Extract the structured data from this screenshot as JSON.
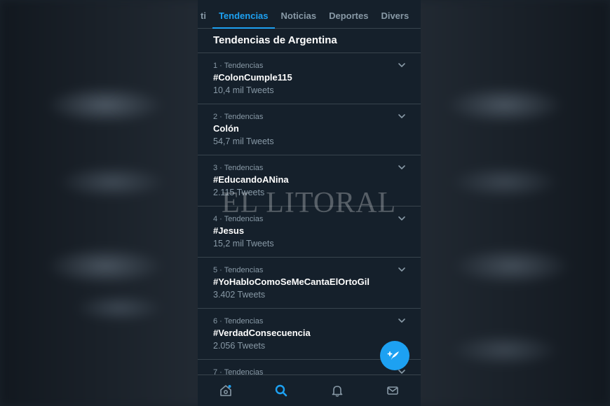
{
  "tabs": [
    {
      "label": "ti",
      "active": false
    },
    {
      "label": "Tendencias",
      "active": true
    },
    {
      "label": "Noticias",
      "active": false
    },
    {
      "label": "Deportes",
      "active": false
    },
    {
      "label": "Divers",
      "active": false
    }
  ],
  "section_title": "Tendencias de Argentina",
  "trends": [
    {
      "meta": "1 · Tendencias",
      "name": "#ColonCumple115",
      "count": "10,4 mil Tweets"
    },
    {
      "meta": "2 · Tendencias",
      "name": "Colón",
      "count": "54,7 mil Tweets"
    },
    {
      "meta": "3 · Tendencias",
      "name": "#EducandoANina",
      "count": "2.115 Tweets"
    },
    {
      "meta": "4 · Tendencias",
      "name": "#Jesus",
      "count": "15,2 mil Tweets"
    },
    {
      "meta": "5 · Tendencias",
      "name": "#YoHabloComoSeMeCantaElOrtoGil",
      "count": "3.402 Tweets"
    },
    {
      "meta": "6 · Tendencias",
      "name": "#VerdadConsecuencia",
      "count": "2.056 Tweets"
    },
    {
      "meta": "7 · Tendencias",
      "name": "",
      "count": ""
    }
  ],
  "watermark": "EL LITORAL",
  "colors": {
    "accent": "#1da1f2",
    "background": "#15202b",
    "muted": "#8899a6"
  },
  "icons": {
    "fab": "compose-tweet-icon",
    "nav": [
      "home-icon",
      "search-icon",
      "notifications-icon",
      "messages-icon"
    ]
  }
}
